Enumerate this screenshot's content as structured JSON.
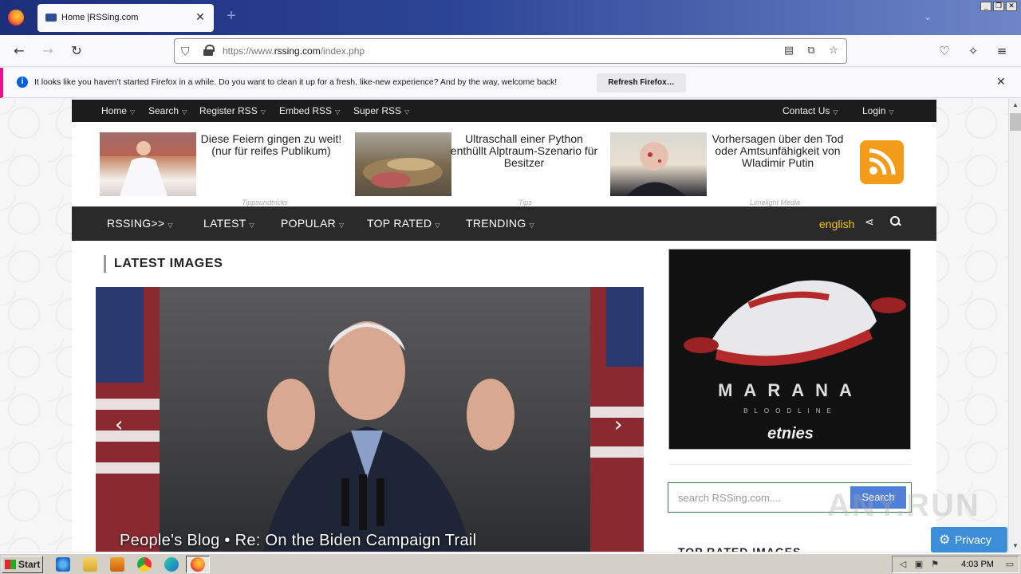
{
  "browser": {
    "tab_title": "Home |RSSing.com",
    "tab_close": "✕",
    "new_tab": "+",
    "url_scheme": "https://www.",
    "url_host": "rssing.com",
    "url_path": "/index.php"
  },
  "notification": {
    "message": "It looks like you haven’t started Firefox in a while. Do you want to clean it up for a fresh, like-new experience? And by the way, welcome back!",
    "button": "Refresh Firefox…",
    "info_glyph": "i",
    "close": "✕"
  },
  "topnav": {
    "items": [
      "Home",
      "Search",
      "Register RSS",
      "Embed RSS",
      "Super RSS"
    ],
    "right": [
      "Contact Us",
      "Login"
    ],
    "caret": "▽"
  },
  "ads": [
    {
      "text": "Diese Feiern gingen zu weit! (nur für reifes Publikum)",
      "source": "Tippsundtricks"
    },
    {
      "text": "Ultraschall einer Python enthüllt Alptraum-Szenario für Besitzer",
      "source": "Tips"
    },
    {
      "text": "Vorhersagen über den Tod oder Amtsunfähigkeit von Wladimir Putin",
      "source": "Limelight Media"
    }
  ],
  "mainnav": {
    "items": [
      "RSSING>>",
      "LATEST",
      "POPULAR",
      "TOP RATED",
      "TRENDING"
    ],
    "language": "english",
    "caret": "▽"
  },
  "latest_images": {
    "title": "LATEST IMAGES",
    "caption": "People's Blog • Re: On the Biden Campaign Trail",
    "prev": "‹",
    "next": "›"
  },
  "banner": {
    "brand": "MARANA",
    "sub": "BLOODLINE",
    "logo": "etnies"
  },
  "sidebar": {
    "search_placeholder": "search RSSing.com....",
    "search_button": "Search",
    "top_rated_title": "TOP RATED IMAGES"
  },
  "privacy": {
    "label": "Privacy"
  },
  "watermark": "ANY.RUN",
  "taskbar": {
    "start": "Start",
    "clock": "4:03 PM"
  },
  "colors": {
    "accent_yellow": "#f5c518",
    "rss_orange": "#f39c1a",
    "search_button": "#4f7fd8",
    "privacy_button": "#3d8ed8",
    "notification_border": "#e31587"
  }
}
